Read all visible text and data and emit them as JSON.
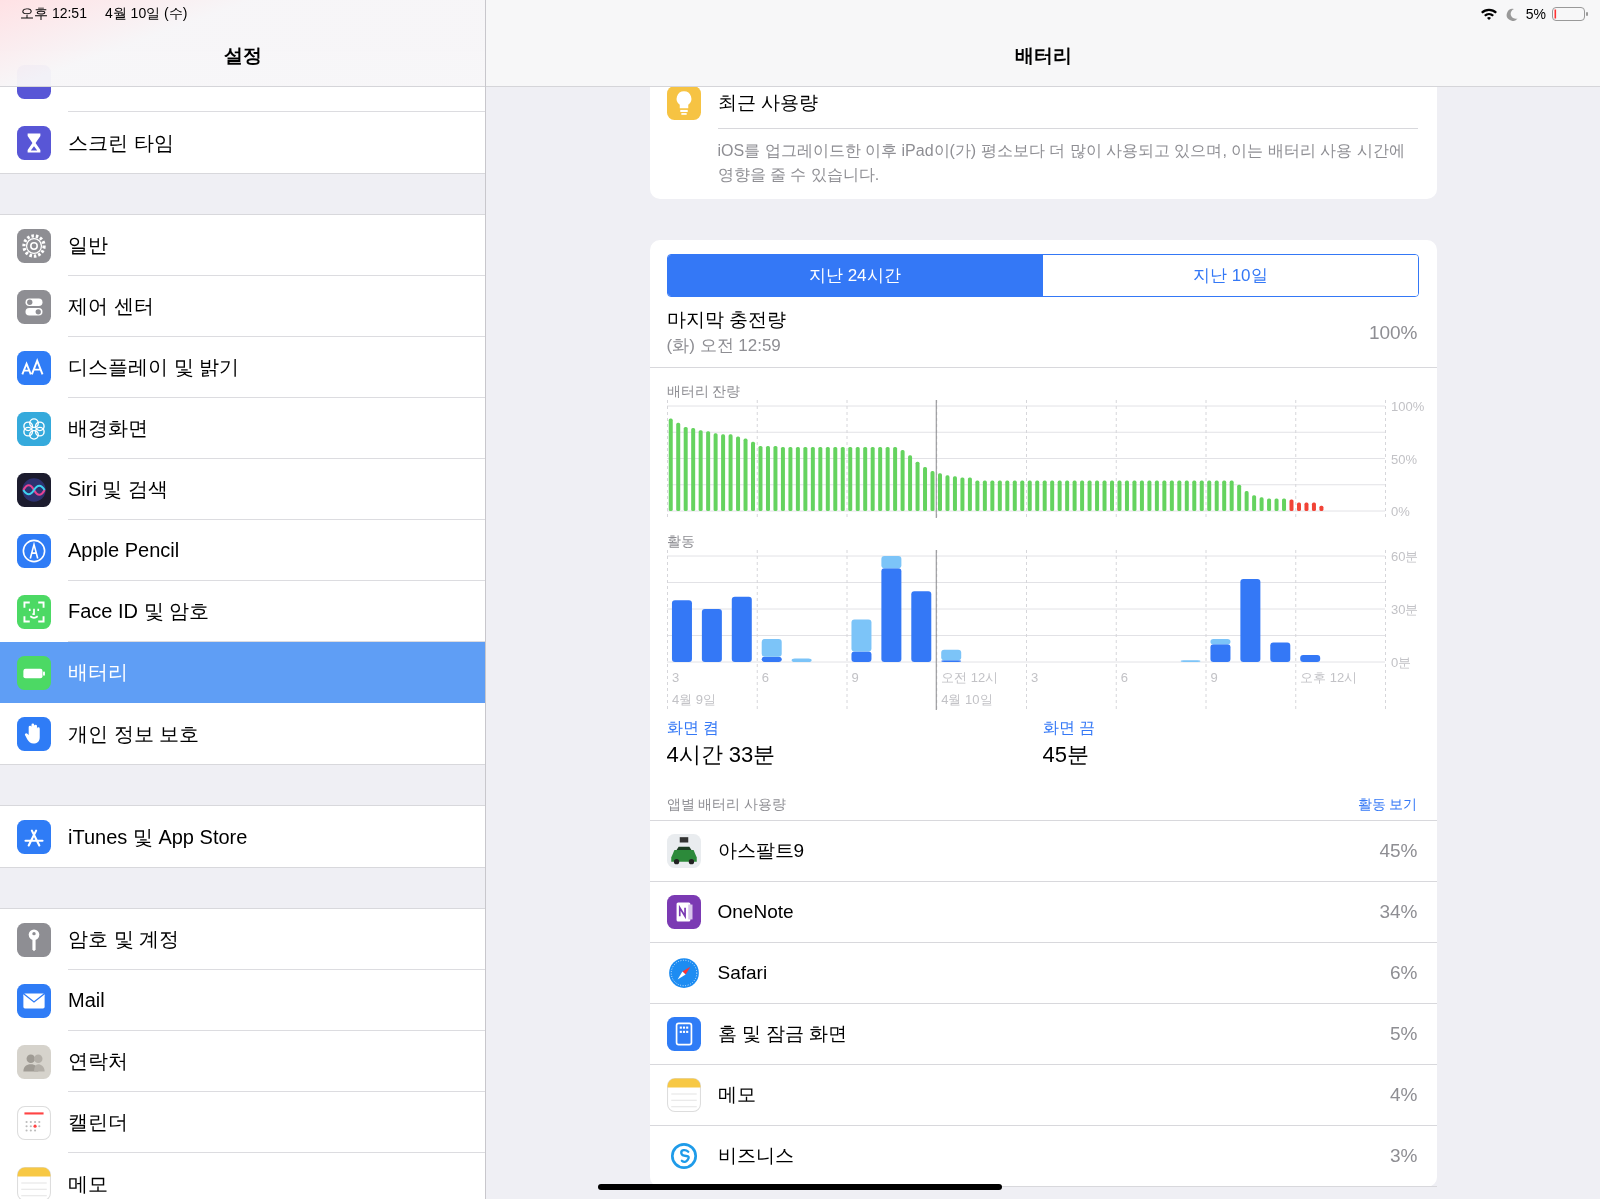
{
  "status_bar": {
    "time": "오후 12:51",
    "date": "4월 10일 (수)",
    "battery": "5%"
  },
  "sidebar": {
    "title": "설정",
    "groups": [
      {
        "items": [
          {
            "label": "스크린 타임",
            "selected": false
          }
        ]
      },
      {
        "items": [
          {
            "label": "일반",
            "selected": false
          },
          {
            "label": "제어 센터",
            "selected": false
          },
          {
            "label": "디스플레이 및 밝기",
            "selected": false
          },
          {
            "label": "배경화면",
            "selected": false
          },
          {
            "label": "Siri 및 검색",
            "selected": false
          },
          {
            "label": "Apple Pencil",
            "selected": false
          },
          {
            "label": "Face ID 및 암호",
            "selected": false
          },
          {
            "label": "배터리",
            "selected": true
          },
          {
            "label": "개인 정보 보호",
            "selected": false
          }
        ]
      },
      {
        "items": [
          {
            "label": "iTunes 및 App Store",
            "selected": false
          }
        ]
      },
      {
        "items": [
          {
            "label": "암호 및 계정",
            "selected": false
          },
          {
            "label": "Mail",
            "selected": false
          },
          {
            "label": "연락처",
            "selected": false
          },
          {
            "label": "캘린더",
            "selected": false
          },
          {
            "label": "메모",
            "selected": false
          }
        ]
      }
    ]
  },
  "detail": {
    "title": "배터리",
    "insight": {
      "title": "최근 사용량",
      "text": "iOS를 업그레이드한 이후 iPad이(가) 평소보다 더 많이 사용되고 있으며, 이는 배터리 사용 시간에 영향을 줄 수 있습니다."
    },
    "tabs": [
      {
        "label": "지난 24시간",
        "selected": true
      },
      {
        "label": "지난 10일",
        "selected": false
      }
    ],
    "last_charge": {
      "label": "마지막 충전량",
      "time": "(화) 오전 12:59",
      "value": "100%"
    },
    "battery_chart": {
      "chart_data": {
        "type": "bar",
        "title": "배터리 잔량",
        "ylim": [
          0,
          100
        ],
        "yticks": [
          {
            "value": 0,
            "label": "0%"
          },
          {
            "value": 50,
            "label": "50%"
          },
          {
            "value": 100,
            "label": "100%"
          }
        ],
        "series": [
          {
            "color": "#65d35f",
            "values": [
              88,
              84,
              80,
              79,
              77,
              76,
              74,
              73,
              73,
              71,
              69,
              66,
              62,
              62,
              62,
              61,
              61,
              61,
              61,
              61,
              61,
              61,
              61,
              61,
              61,
              61,
              61,
              61,
              61,
              61,
              61,
              58,
              53,
              47,
              42,
              38,
              36,
              34,
              33,
              32,
              32,
              29,
              29,
              29,
              29,
              29,
              29,
              29,
              29,
              29,
              29,
              29,
              29,
              29,
              29,
              29,
              29,
              29,
              29,
              29,
              29,
              29,
              29,
              29,
              29,
              29,
              29,
              29,
              29,
              29,
              29,
              29,
              29,
              29,
              29,
              29,
              25,
              19,
              15,
              13,
              12,
              12,
              12,
              null,
              null,
              null,
              null,
              null,
              null,
              null,
              null,
              null,
              null,
              null,
              null,
              null
            ]
          },
          {
            "color": "#f14336",
            "values": [
              null,
              null,
              null,
              null,
              null,
              null,
              null,
              null,
              null,
              null,
              null,
              null,
              null,
              null,
              null,
              null,
              null,
              null,
              null,
              null,
              null,
              null,
              null,
              null,
              null,
              null,
              null,
              null,
              null,
              null,
              null,
              null,
              null,
              null,
              null,
              null,
              null,
              null,
              null,
              null,
              null,
              null,
              null,
              null,
              null,
              null,
              null,
              null,
              null,
              null,
              null,
              null,
              null,
              null,
              null,
              null,
              null,
              null,
              null,
              null,
              null,
              null,
              null,
              null,
              null,
              null,
              null,
              null,
              null,
              null,
              null,
              null,
              null,
              null,
              null,
              null,
              null,
              null,
              null,
              null,
              null,
              null,
              null,
              11,
              8,
              8,
              8,
              5,
              null,
              null,
              null,
              null,
              null,
              null,
              null,
              null
            ]
          }
        ]
      }
    },
    "activity_chart": {
      "chart_data": {
        "type": "bar",
        "title": "활동",
        "stacked": true,
        "categories": [
          "3",
          null,
          null,
          "6",
          null,
          null,
          "9",
          null,
          null,
          "오전 12시",
          null,
          null,
          "3",
          null,
          null,
          "6",
          null,
          null,
          "9",
          null,
          null,
          "오후 12시",
          null,
          null
        ],
        "ylim": [
          0,
          60
        ],
        "yticks": [
          {
            "value": 0,
            "label": "0분"
          },
          {
            "value": 30,
            "label": "30분"
          },
          {
            "value": 60,
            "label": "60분"
          }
        ],
        "annotations": [
          "4월 9일",
          "4월 10일"
        ],
        "series": [
          {
            "color": "#3478f6",
            "values": [
              35,
              30,
              37,
              3,
              0,
              0,
              6,
              53,
              40,
              1,
              0,
              0,
              0,
              0,
              0,
              0,
              0,
              0,
              10,
              47,
              11,
              4,
              null,
              null
            ]
          },
          {
            "color": "#7cc4f8",
            "values": [
              0,
              0,
              0,
              10,
              2,
              0,
              18,
              7,
              0,
              6,
              0,
              0,
              0,
              0,
              0,
              0,
              0,
              1,
              3,
              0,
              0,
              0,
              null,
              null
            ]
          }
        ]
      }
    },
    "screen_stats": [
      {
        "label": "화면 켬",
        "value": "4시간 33분"
      },
      {
        "label": "화면 끔",
        "value": "45분"
      }
    ],
    "app_usage": {
      "title": "앱별 배터리 사용량",
      "action": "활동 보기",
      "apps": [
        {
          "name": "아스팔트9",
          "percent": "45%"
        },
        {
          "name": "OneNote",
          "percent": "34%"
        },
        {
          "name": "Safari",
          "percent": "6%"
        },
        {
          "name": "홈 및 잠금 화면",
          "percent": "5%"
        },
        {
          "name": "메모",
          "percent": "4%"
        },
        {
          "name": "비즈니스",
          "percent": "3%"
        }
      ]
    }
  }
}
